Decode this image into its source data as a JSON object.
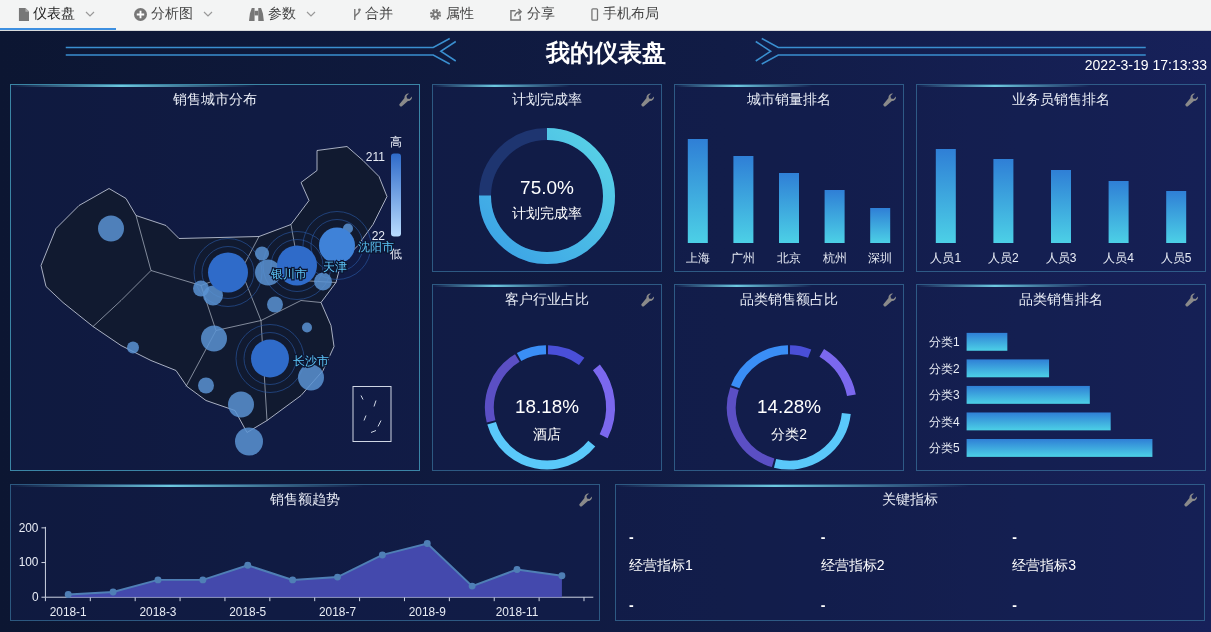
{
  "toolbar": {
    "items": [
      {
        "label": "仪表盘",
        "selected": true,
        "dropdown": true
      },
      {
        "label": "分析图",
        "selected": false,
        "dropdown": true
      },
      {
        "label": "参数",
        "selected": false,
        "dropdown": true
      },
      {
        "label": "合并",
        "selected": false,
        "dropdown": false
      },
      {
        "label": "属性",
        "selected": false,
        "dropdown": false
      },
      {
        "label": "分享",
        "selected": false,
        "dropdown": false
      },
      {
        "label": "手机布局",
        "selected": false,
        "dropdown": false
      }
    ]
  },
  "dashboard": {
    "title": "我的仪表盘",
    "datetime": "2022-3-19 17:13:33"
  },
  "panels": [
    {
      "kind": "map",
      "title": "销售城市分布",
      "city_labels": [
        "银川市",
        "天津",
        "沈阳市",
        "长沙市"
      ],
      "legend": {
        "high_label": "高",
        "max": "211",
        "min": "22",
        "low_label": "低"
      }
    },
    {
      "kind": "gauge",
      "title": "计划完成率",
      "level": 0.75,
      "value": "75.0%",
      "label": "计划完成率"
    },
    {
      "kind": "bar",
      "title": "城市销量排名",
      "categories": [
        "上海",
        "广州",
        "北京",
        "杭州",
        "深圳"
      ]
    },
    {
      "kind": "bar",
      "title": "业务员销售排名",
      "categories": [
        "人员1",
        "人员2",
        "人员3",
        "人员4",
        "人员5"
      ]
    },
    {
      "kind": "donut",
      "title": "客户行业占比",
      "value": "18.18%",
      "label": "酒店"
    },
    {
      "kind": "donut",
      "title": "品类销售额占比",
      "value": "14.28%",
      "label": "分类2"
    },
    {
      "kind": "hbar",
      "title": "品类销售排名",
      "categories": [
        "分类1",
        "分类2",
        "分类3",
        "分类4",
        "分类5"
      ]
    },
    {
      "kind": "area",
      "title": "销售额趋势",
      "chart_data": {
        "type": "area",
        "categories": [
          "2018-1",
          null,
          "2018-3",
          null,
          "2018-5",
          null,
          "2018-7",
          null,
          "2018-9",
          null,
          "2018-11",
          null
        ],
        "values": [
          8,
          15,
          50,
          50,
          92,
          50,
          58,
          122,
          155,
          32,
          80,
          62
        ],
        "ylim": [
          0,
          200
        ],
        "yticks": [
          0,
          100,
          200
        ]
      }
    },
    {
      "kind": "metrics",
      "title": "关键指标",
      "metrics": [
        {
          "value": "-",
          "label": "经营指标1",
          "sub_value": "-"
        },
        {
          "value": "-",
          "label": "经营指标2",
          "sub_value": "-"
        },
        {
          "value": "-",
          "label": "经营指标3",
          "sub_value": "-"
        }
      ]
    }
  ]
}
